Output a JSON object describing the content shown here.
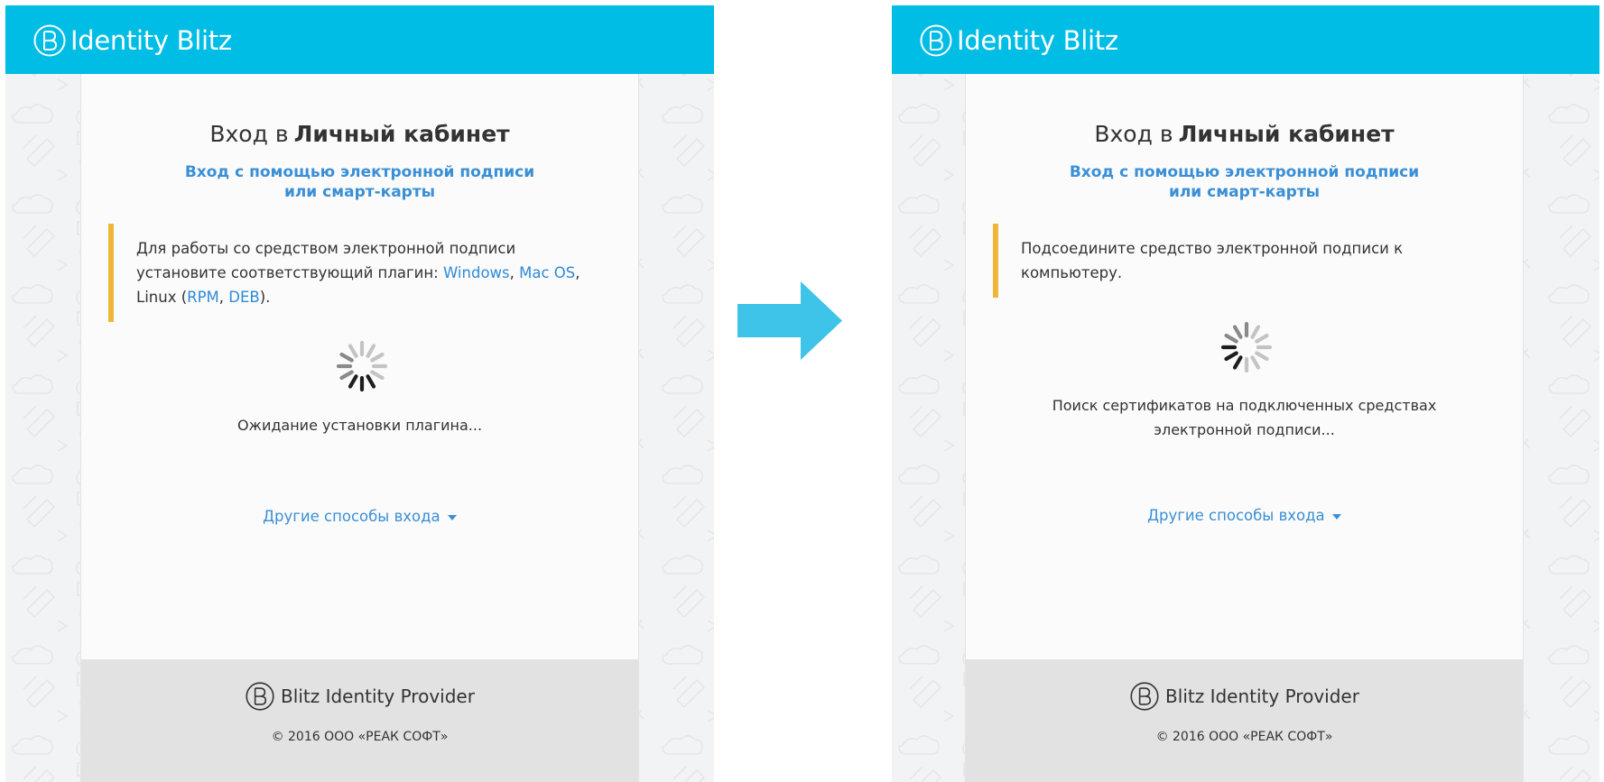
{
  "screens": [
    {
      "app_title": "Identity Blitz",
      "heading_prefix": "Вход в",
      "heading_bold": "Личный кабинет",
      "subtitle": "Вход с помощью электронной подписи или смарт-карты",
      "notice": {
        "text_1": "Для работы со средством электронной подписи установите соответствующий плагин: ",
        "link_windows": "Windows",
        "sep_1": ", ",
        "link_macos": "Mac OS",
        "text_2": ", Linux (",
        "link_rpm": "RPM",
        "sep_2": ", ",
        "link_deb": "DEB",
        "text_3": ")."
      },
      "status": "Ожидание установки плагина...",
      "other_methods": "Другие способы входа",
      "footer_brand": "Blitz Identity Provider",
      "copyright": "© 2016 ООО «РЕАК СОФТ»"
    },
    {
      "app_title": "Identity Blitz",
      "heading_prefix": "Вход в",
      "heading_bold": "Личный кабинет",
      "subtitle": "Вход с помощью электронной подписи или смарт-карты",
      "notice_text": "Подсоедините средство электронной подписи к компьютеру.",
      "status": "Поиск сертификатов на подключенных средствах электронной подписи...",
      "other_methods": "Другие способы входа",
      "footer_brand": "Blitz Identity Provider",
      "copyright": "© 2016 ООО «РЕАК СОФТ»"
    }
  ],
  "colors": {
    "header": "#00bde6",
    "arrow": "#3ec3e9",
    "link": "#3a8fd6",
    "notice_border": "#f0b63a",
    "footer": "#e2e2e2",
    "panel": "#fbfbfb"
  },
  "icons": {
    "logo": "circled-b-logo-icon",
    "dropdown": "caret-down-icon",
    "loading": "loading-spinner-icon",
    "transition": "right-arrow-icon"
  }
}
